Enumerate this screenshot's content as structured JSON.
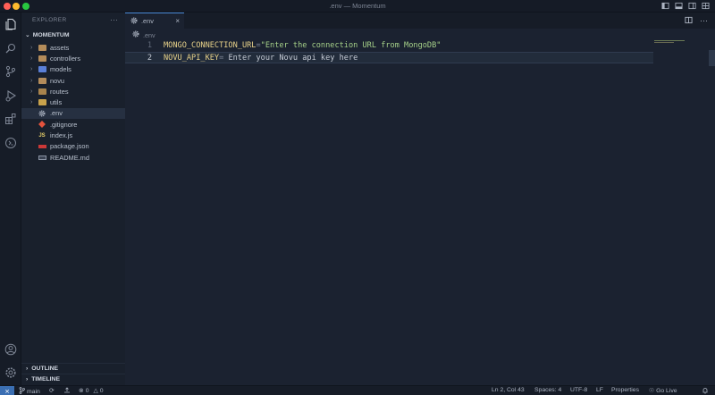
{
  "window": {
    "title": ".env — Momentum"
  },
  "sidebar": {
    "header": "EXPLORER",
    "more": "···",
    "project": "MOMENTUM",
    "items": [
      {
        "label": "assets",
        "type": "folder",
        "color": "#b48c5a"
      },
      {
        "label": "controllers",
        "type": "folder",
        "color": "#b48c5a"
      },
      {
        "label": "models",
        "type": "folder",
        "color": "#5a7fd6"
      },
      {
        "label": "novu",
        "type": "folder",
        "color": "#b48c5a"
      },
      {
        "label": "routes",
        "type": "folder",
        "color": "#a8834c"
      },
      {
        "label": "utils",
        "type": "folder",
        "color": "#c8a24c"
      },
      {
        "label": ".env",
        "type": "file",
        "icon": "gear-icon",
        "color": "#aeb6c4",
        "active": true
      },
      {
        "label": ".gitignore",
        "type": "file",
        "icon": "git-icon",
        "color": "#e5533d"
      },
      {
        "label": "index.js",
        "type": "file",
        "icon": "js-icon",
        "color": "#e8d06a"
      },
      {
        "label": "package.json",
        "type": "file",
        "icon": "npm-icon",
        "color": "#cb3837"
      },
      {
        "label": "README.md",
        "type": "file",
        "icon": "markdown-icon",
        "color": "#8a93a3"
      }
    ],
    "outline": "OUTLINE",
    "timeline": "TIMELINE"
  },
  "tabs": [
    {
      "label": ".env",
      "active": true
    }
  ],
  "breadcrumb": {
    "file": ".env"
  },
  "editor": {
    "lines": [
      {
        "number": "1",
        "key": "MONGO_CONNECTION_URL",
        "eq": "=",
        "value": "\"Enter the connection URL from MongoDB\""
      },
      {
        "number": "2",
        "key": "NOVU_API_KEY",
        "eq": "=",
        "value": " Enter your Novu api key here"
      }
    ],
    "current_line": 2
  },
  "status": {
    "branch": "main",
    "errors": "0",
    "warnings": "0",
    "position": "Ln 2, Col 43",
    "spaces": "Spaces: 4",
    "encoding": "UTF-8",
    "eol": "LF",
    "language": "Properties",
    "golive": "Go Live"
  },
  "colors": {
    "accent": "#4a8ad8",
    "remote": "#3b6fb3",
    "key": "#e8d28a",
    "string": "#a6d189"
  }
}
